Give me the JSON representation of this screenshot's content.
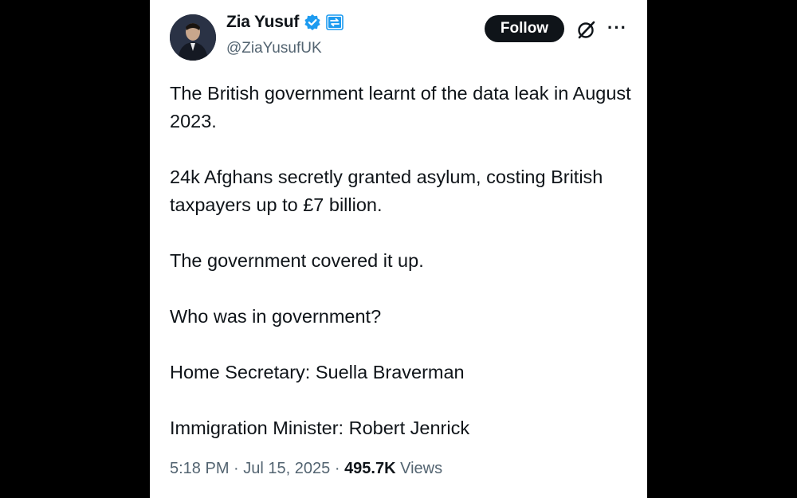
{
  "author": {
    "display_name": "Zia Yusuf",
    "handle": "@ZiaYusufUK",
    "verified": true
  },
  "follow_label": "Follow",
  "tweet": {
    "paragraphs": [
      "The British government learnt of the data leak in August 2023.",
      "24k Afghans secretly granted asylum, costing British taxpayers up to £7 billion.",
      "The government covered it up.",
      "Who was in government?",
      "Home Secretary: Suella Braverman",
      "Immigration Minister: Robert Jenrick"
    ]
  },
  "meta": {
    "time": "5:18 PM",
    "separator": "·",
    "date": "Jul 15, 2025",
    "views_count": "495.7K",
    "views_label": "Views"
  },
  "icons": {
    "verified": "verified-badge-icon",
    "affiliation": "affiliate-badge-icon",
    "grok": "grok-icon",
    "more": "more-icon"
  },
  "colors": {
    "verified_blue": "#1d9bf0",
    "text_primary": "#0f1419",
    "text_secondary": "#536471",
    "follow_bg": "#0f1419"
  }
}
